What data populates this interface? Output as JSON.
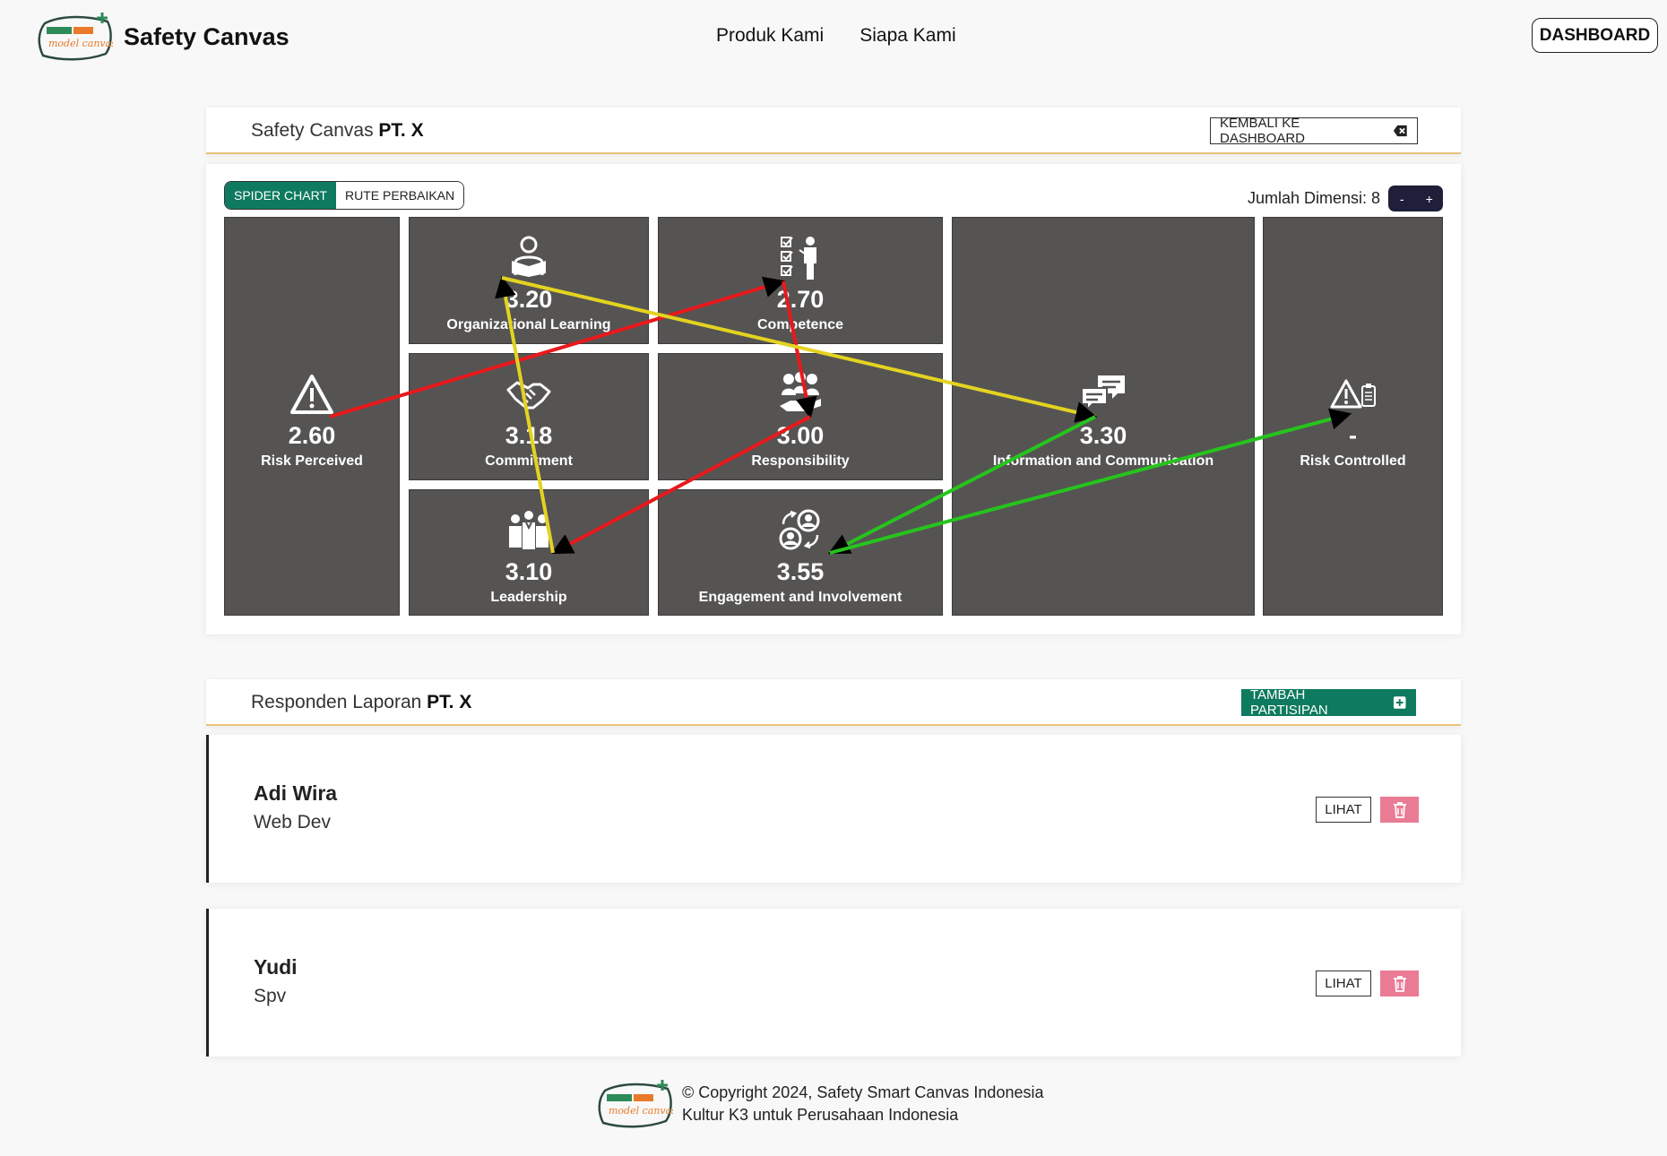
{
  "app": {
    "brand": "Safety Canvas",
    "logo_icon": "safety-smart-canvas-logo"
  },
  "nav": {
    "links": [
      "Produk Kami",
      "Siapa Kami"
    ],
    "dashboard": "DASHBOARD"
  },
  "canvas_card": {
    "title_prefix": "Safety Canvas",
    "title_company": "PT. X",
    "back_button": "KEMBALI KE DASHBOARD"
  },
  "tabs": [
    {
      "label": "SPIDER CHART",
      "active": true
    },
    {
      "label": "RUTE PERBAIKAN",
      "active": false
    }
  ],
  "dimension": {
    "label": "Jumlah Dimensi: 8",
    "minus": "-",
    "plus": "+"
  },
  "tiles": [
    {
      "value": "2.60",
      "label": "Risk Perceived",
      "icon": "warning-icon"
    },
    {
      "value": "3.20",
      "label": "Organizational Learning",
      "icon": "reading-person-icon"
    },
    {
      "value": "2.70",
      "label": "Competence",
      "icon": "checklist-presenter-icon"
    },
    {
      "value": "3.18",
      "label": "Commitment",
      "icon": "handshake-icon"
    },
    {
      "value": "3.00",
      "label": "Responsibility",
      "icon": "team-hand-icon"
    },
    {
      "value": "3.10",
      "label": "Leadership",
      "icon": "leader-group-icon"
    },
    {
      "value": "3.55",
      "label": "Engagement and Involvement",
      "icon": "user-cycle-icon"
    },
    {
      "value": "3.30",
      "label": "Information and Communication",
      "icon": "chat-bubbles-icon"
    },
    {
      "value": "-",
      "label": "Risk Controlled",
      "icon": "warning-clipboard-icon"
    }
  ],
  "route_colors": {
    "red": "#e8191c",
    "yellow": "#e3d320",
    "green": "#26c41d"
  },
  "respondents_card": {
    "title_prefix": "Responden Laporan",
    "title_company": "PT. X",
    "add_button": "TAMBAH PARTISIPAN"
  },
  "respondents": [
    {
      "name": "Adi Wira",
      "role": "Web Dev",
      "view": "LIHAT"
    },
    {
      "name": "Yudi",
      "role": "Spv",
      "view": "LIHAT"
    }
  ],
  "footer": {
    "line1": "© Copyright 2024, Safety Smart Canvas Indonesia",
    "line2": "Kultur K3 untuk Perusahaan Indonesia"
  },
  "colors": {
    "accent_green": "#0e7a5f",
    "tile_bg": "#555453",
    "delete_pink": "#ea7b95",
    "header_underline": "#e8c27a"
  }
}
